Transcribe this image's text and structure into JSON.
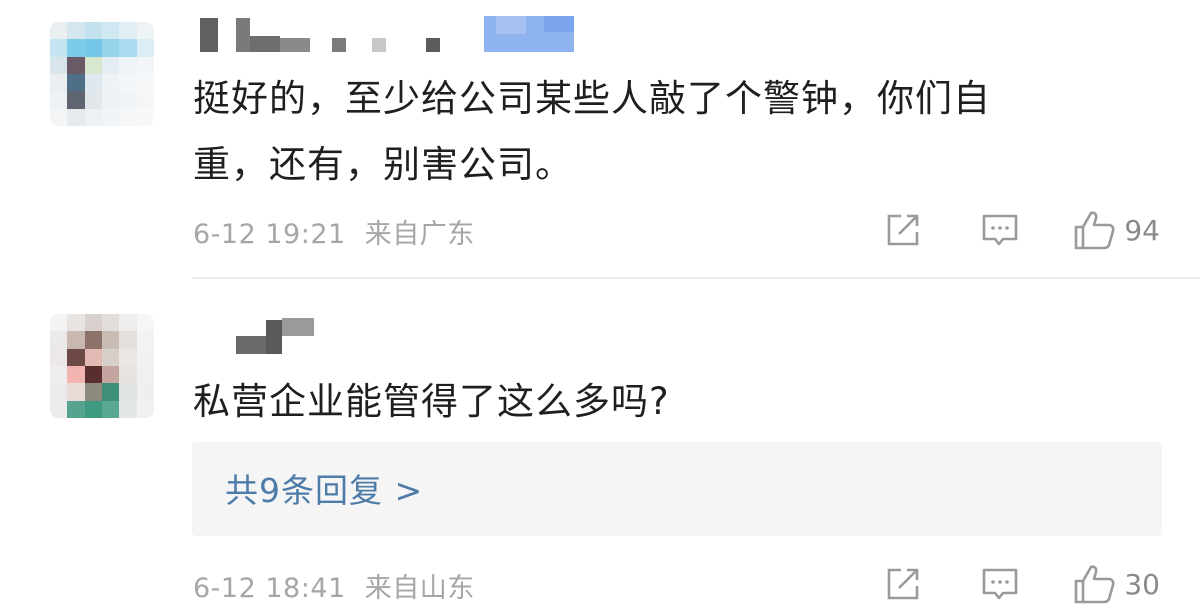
{
  "comments": [
    {
      "text_line1": "挺好的，至少给公司某些人敲了个警钟，你们自",
      "text_line2": "重，还有，别害公司。",
      "timestamp": "6-12 19:21",
      "location": "来自广东",
      "likes": "94",
      "icons": [
        "share-icon",
        "comment-icon",
        "thumbs-up-icon"
      ]
    },
    {
      "text_line1": "私营企业能管得了这么多吗?",
      "timestamp": "6-12 18:41",
      "location": "来自山东",
      "likes": "30",
      "reply_link": "共9条回复 >",
      "icons": [
        "share-icon",
        "comment-icon",
        "thumbs-up-icon"
      ]
    }
  ],
  "colors": {
    "link": "#4e7ca8",
    "meta_text": "#a6a6a6",
    "icon": "#9a9a9a",
    "reply_bg": "#f5f5f5"
  }
}
